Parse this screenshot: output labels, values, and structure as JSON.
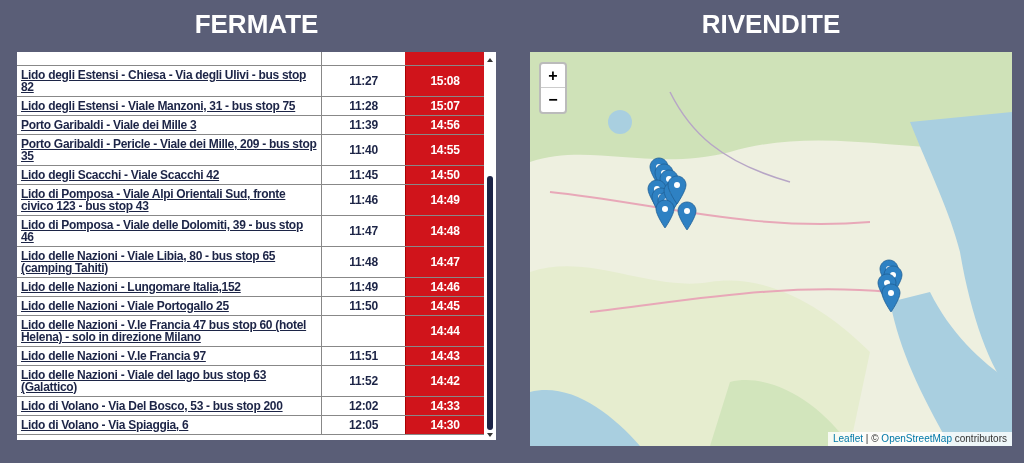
{
  "stops_panel": {
    "title": "FERMATE",
    "rows": [
      {
        "stop": "Lido degli Estensi - Chiesa - Via degli Ulivi - bus stop 82",
        "time_1": "11:27",
        "time_2": "15:08"
      },
      {
        "stop": "Lido degli Estensi - Viale Manzoni, 31 - bus stop 75",
        "time_1": "11:28",
        "time_2": "15:07"
      },
      {
        "stop": "Porto Garibaldi - Viale dei Mille 3",
        "time_1": "11:39",
        "time_2": "14:56"
      },
      {
        "stop": "Porto Garibaldi - Pericle - Viale dei Mille, 209 - bus stop 35",
        "time_1": "11:40",
        "time_2": "14:55"
      },
      {
        "stop": "Lido degli Scacchi - Viale Scacchi 42",
        "time_1": "11:45",
        "time_2": "14:50"
      },
      {
        "stop": "Lido di Pomposa - Viale Alpi Orientali Sud, fronte civico 123 - bus stop 43",
        "time_1": "11:46",
        "time_2": "14:49"
      },
      {
        "stop": "Lido di Pomposa - Viale delle Dolomiti, 39 - bus stop 46",
        "time_1": "11:47",
        "time_2": "14:48"
      },
      {
        "stop": "Lido delle Nazioni - Viale Libia, 80 - bus stop 65 (camping Tahiti)",
        "time_1": "11:48",
        "time_2": "14:47"
      },
      {
        "stop": "Lido delle Nazioni - Lungomare Italia,152",
        "time_1": "11:49",
        "time_2": "14:46"
      },
      {
        "stop": "Lido delle Nazioni - Viale Portogallo 25",
        "time_1": "11:50",
        "time_2": "14:45"
      },
      {
        "stop": "Lido delle Nazioni - V.le Francia 47 bus stop 60 (hotel Helena) - solo in direzione Milano",
        "time_2": "14:44"
      },
      {
        "stop": "Lido delle Nazioni - V.le Francia 97",
        "time_1": "11:51",
        "time_2": "14:43"
      },
      {
        "stop": "Lido delle Nazioni - Viale del lago bus stop 63 (Galattico)",
        "time_1": "11:52",
        "time_2": "14:42"
      },
      {
        "stop": "Lido di Volano - Via Del Bosco, 53 - bus stop 200",
        "time_1": "12:02",
        "time_2": "14:33"
      },
      {
        "stop": "Lido di Volano - Via Spiaggia, 6",
        "time_1": "12:05",
        "time_2": "14:30"
      }
    ]
  },
  "resellers_panel": {
    "title": "RIVENDITE",
    "map": {
      "kind": "picture",
      "zoom_in": "+",
      "zoom_out": "−",
      "attribution": {
        "link_1": "Leaflet",
        "separator": "|",
        "prefix": "©",
        "link_2": "OpenStreetMap",
        "suffix": "contributors"
      }
    }
  }
}
